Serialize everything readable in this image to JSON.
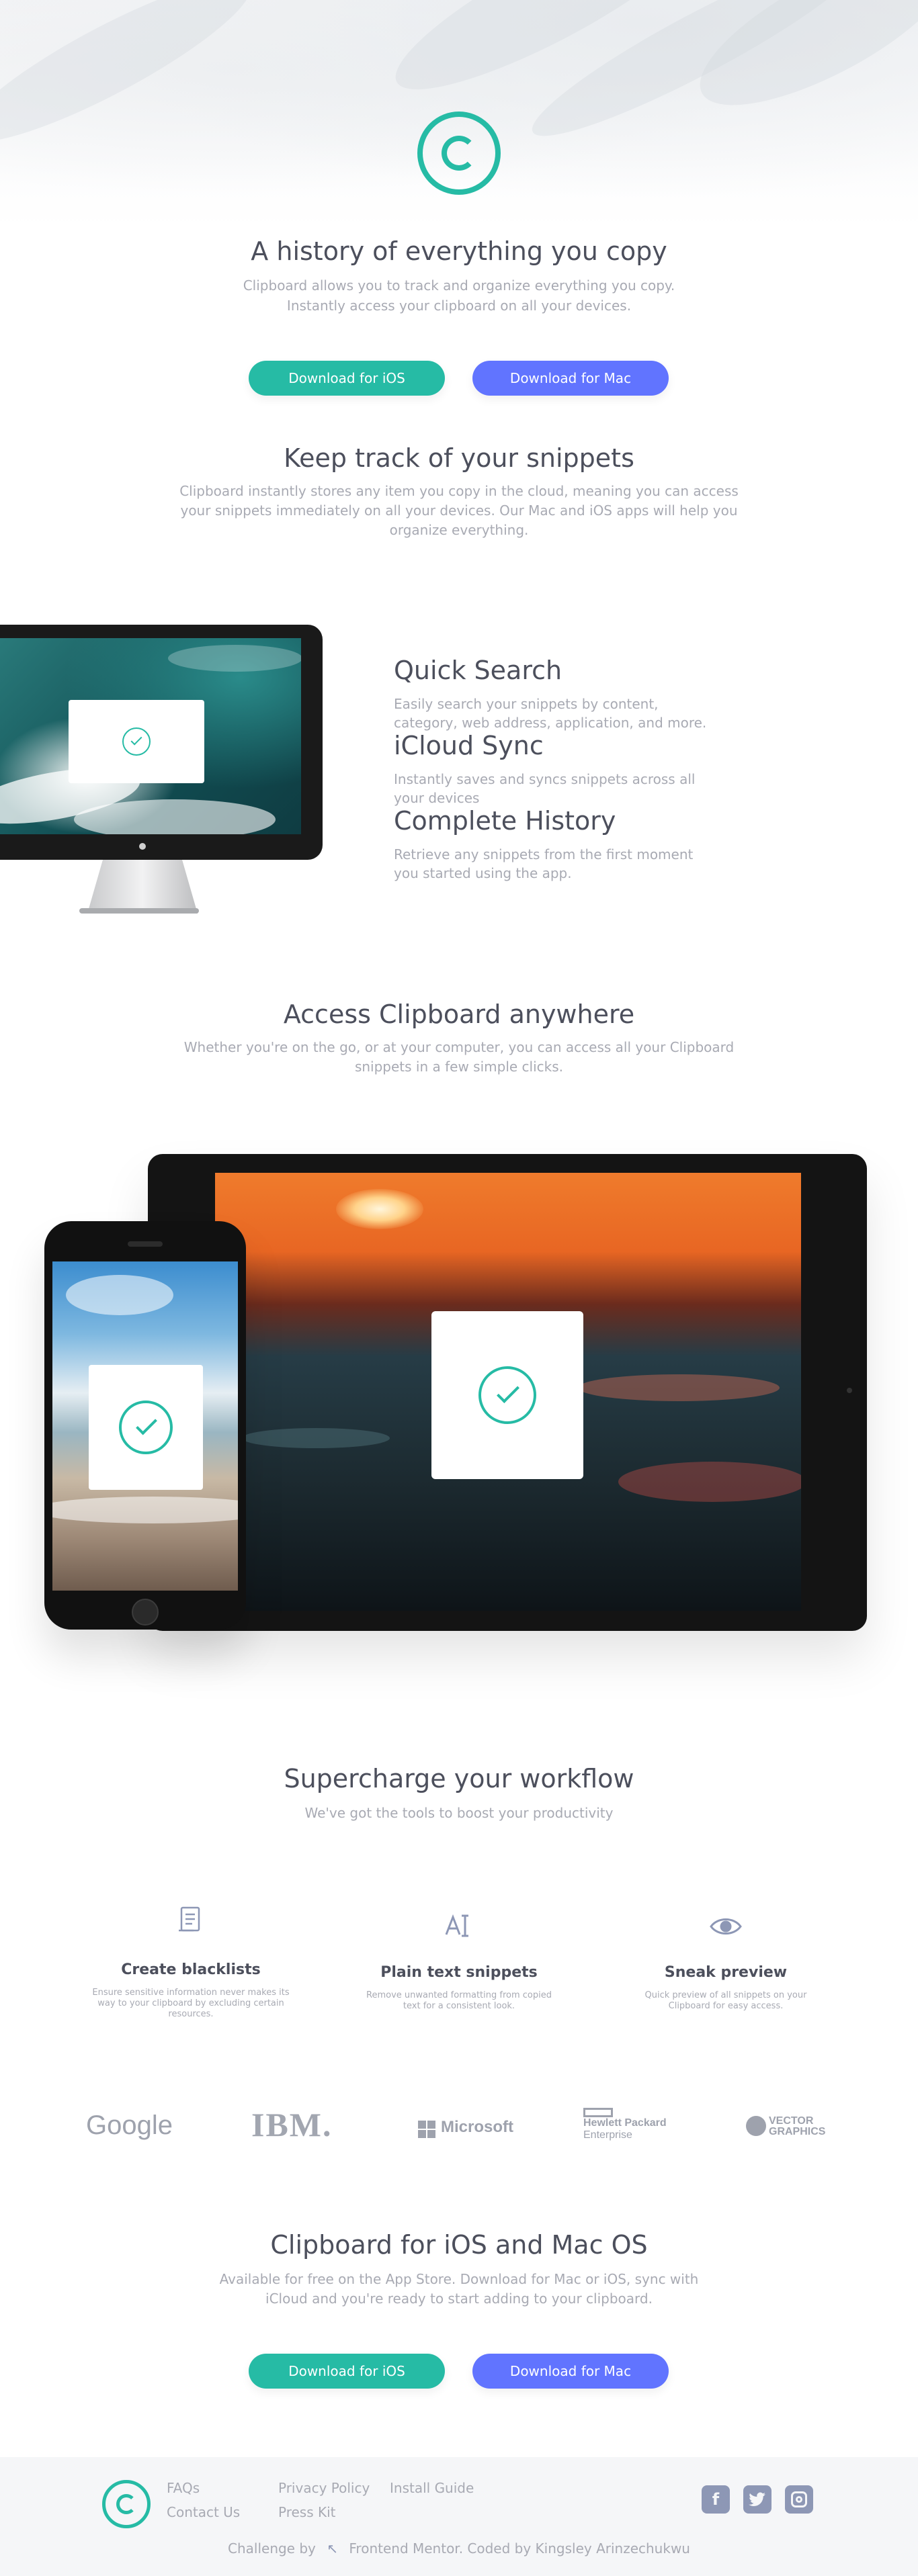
{
  "hero": {
    "title": "A history of everything you copy",
    "text_line1": "Clipboard allows you to track and organize everything you copy.",
    "text_line2": "Instantly access your clipboard on all your devices.",
    "btn_ios": "Download for iOS",
    "btn_mac": "Download for Mac"
  },
  "snippets": {
    "title": "Keep track of your snippets",
    "line1": "Clipboard instantly stores any item you copy in the cloud, meaning you can access",
    "line2": "your snippets immediately on all your devices. Our Mac and iOS apps will help you",
    "line3": "organize everything."
  },
  "features": [
    {
      "title": "Quick Search",
      "line1": "Easily search your snippets by content,",
      "line2": "category, web address, application, and more."
    },
    {
      "title": "iCloud Sync",
      "line1": "Instantly saves and syncs snippets across all",
      "line2": "your devices"
    },
    {
      "title": "Complete History",
      "line1": "Retrieve any snippets from the first moment",
      "line2": "you started using the app."
    }
  ],
  "access": {
    "title": "Access Clipboard anywhere",
    "line1": "Whether you're on the go, or at your computer, you can access all your Clipboard",
    "line2": "snippets in a few simple clicks."
  },
  "workflow": {
    "title": "Supercharge your workflow",
    "subtitle": "We've got the tools to boost your productivity",
    "items": [
      {
        "icon": "blacklist-icon",
        "title": "Create blacklists",
        "line1": "Ensure sensitive information never makes its",
        "line2": "way to your clipboard by excluding certain",
        "line3": "resources."
      },
      {
        "icon": "text-cursor-icon",
        "title": "Plain text snippets",
        "line1": "Remove unwanted formatting from copied",
        "line2": "text for a consistent look.",
        "line3": ""
      },
      {
        "icon": "eye-icon",
        "title": "Sneak preview",
        "line1": "Quick preview of all snippets on your",
        "line2": "Clipboard for easy access.",
        "line3": ""
      }
    ]
  },
  "brands": {
    "google": "Google",
    "ibm": "IBM.",
    "microsoft": "Microsoft",
    "hp_line1": "Hewlett Packard",
    "hp_line2": "Enterprise",
    "vector_line1": "VECTOR",
    "vector_line2": "GRAPHICS"
  },
  "cta": {
    "title": "Clipboard for iOS and Mac OS",
    "line1": "Available for free on the App Store. Download for Mac or iOS, sync with",
    "line2": "iCloud and you're ready to start adding to your clipboard.",
    "btn_ios": "Download for iOS",
    "btn_mac": "Download for Mac"
  },
  "footer": {
    "faqs": "FAQs",
    "contact": "Contact Us",
    "privacy": "Privacy Policy",
    "press": "Press Kit",
    "install": "Install Guide",
    "attribution_prefix": "Challenge by",
    "attribution_rest": "Frontend Mentor. Coded by Kingsley Arinzechukwu",
    "social": [
      "facebook-icon",
      "twitter-icon",
      "instagram-icon"
    ]
  },
  "colors": {
    "accent_green": "#26bba5",
    "accent_blue": "#6174ff",
    "heading": "#4c4f5c",
    "body_text": "#a8aab3"
  }
}
